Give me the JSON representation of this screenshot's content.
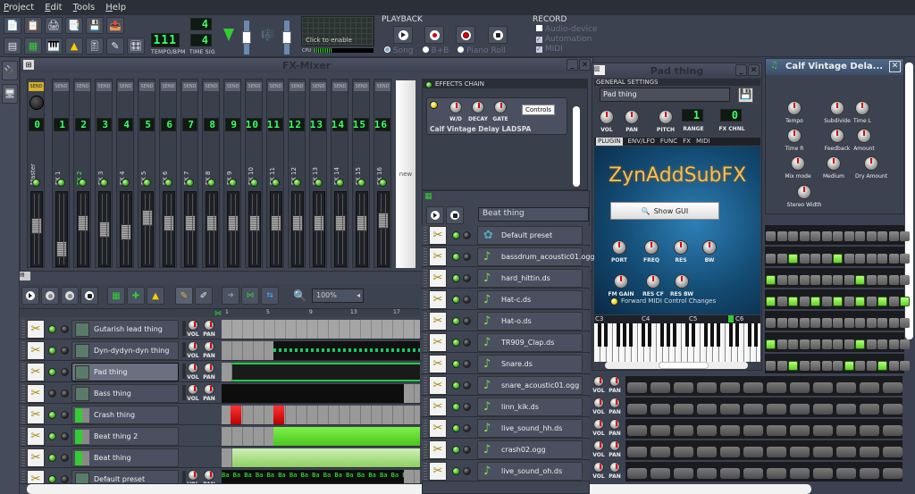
{
  "menu": [
    "Project",
    "Edit",
    "Tools",
    "Help"
  ],
  "toolbar": {
    "tempo": "111",
    "tempo_label": "TEMPO/BPM",
    "timesig_num": "4",
    "timesig_den": "4",
    "timesig_label": "TIME SIG",
    "cpu_label": "CPU",
    "graph_text": "Click to enable",
    "playback_label": "PLAYBACK",
    "modes": [
      "Song",
      "B+B",
      "Piano Roll"
    ],
    "selected_mode": "Song",
    "record_label": "RECORD",
    "record_options": [
      {
        "label": "Audio-device",
        "checked": false
      },
      {
        "label": "Automation",
        "checked": true
      },
      {
        "label": "MIDI",
        "checked": true
      }
    ]
  },
  "fxmixer": {
    "title": "FX-Mixer",
    "send_label": "SEND",
    "new_label": "new",
    "channels": [
      {
        "num": "0",
        "name": "Master",
        "level": 0.55
      },
      {
        "num": "1",
        "name": "FX 1",
        "level": 0.15
      },
      {
        "num": "2",
        "name": "FX 2",
        "level": 0.6,
        "active": true
      },
      {
        "num": "3",
        "name": "FX 3",
        "level": 0.5
      },
      {
        "num": "4",
        "name": "FX 4",
        "level": 0.45
      },
      {
        "num": "5",
        "name": "FX 5",
        "level": 0.7
      },
      {
        "num": "6",
        "name": "FX 6",
        "level": 0.6
      },
      {
        "num": "7",
        "name": "FX 7",
        "level": 0.6
      },
      {
        "num": "8",
        "name": "FX 8",
        "level": 0.6
      },
      {
        "num": "9",
        "name": "FX 9",
        "level": 0.6
      },
      {
        "num": "10",
        "name": "FX 10",
        "level": 0.6
      },
      {
        "num": "11",
        "name": "FX 11",
        "level": 0.6
      },
      {
        "num": "12",
        "name": "FX 12",
        "level": 0.6
      },
      {
        "num": "13",
        "name": "FX 13",
        "level": 0.6
      },
      {
        "num": "14",
        "name": "FX 14",
        "level": 0.6
      },
      {
        "num": "15",
        "name": "FX 15",
        "level": 0.6
      },
      {
        "num": "16",
        "name": "FX 16",
        "level": 0.65
      }
    ],
    "effects_chain": {
      "label": "EFFECTS CHAIN",
      "plugin": "Calf Vintage Delay LADSPA",
      "knobs": [
        "W/D",
        "DECAY",
        "GATE"
      ],
      "controls_btn": "Controls"
    }
  },
  "song_editor": {
    "zoom": "100%",
    "ruler": [
      "1",
      "5",
      "9",
      "13",
      "17"
    ],
    "tracks": [
      {
        "name": "Gutarish lead thing",
        "type": "synth"
      },
      {
        "name": "Dyn-dydyn-dyn thing",
        "type": "synth"
      },
      {
        "name": "Pad thing",
        "type": "synth",
        "selected": true
      },
      {
        "name": "Bass thing",
        "type": "synth"
      },
      {
        "name": "Crash thing",
        "type": "bb"
      },
      {
        "name": "Beat thing 2",
        "type": "bb"
      },
      {
        "name": "Beat thing",
        "type": "bb"
      },
      {
        "name": "Default preset",
        "type": "synth"
      }
    ],
    "vol_label": "VOL",
    "pan_label": "PAN",
    "pattern_label": "Ba"
  },
  "bb_editor": {
    "selected": "Beat thing",
    "tracks": [
      "Default preset",
      "bassdrum_acoustic01.ogg",
      "hard_hittin.ds",
      "Hat-c.ds",
      "Hat-o.ds",
      "TR909_Clap.ds",
      "Snare.ds",
      "snare_acoustic01.ogg",
      "linn_kik.ds",
      "live_sound_hh.ds",
      "crash02.ogg",
      "live_sound_oh.ds"
    ]
  },
  "instrument": {
    "title": "Pad thing",
    "general_label": "GENERAL SETTINGS",
    "name": "Pad thing",
    "knobs": [
      "VOL",
      "PAN",
      "PITCH"
    ],
    "range_label": "RANGE",
    "range": "1",
    "fx_label": "FX CHNL",
    "fx": "0",
    "tabs": [
      "PLUGIN",
      "ENV/LFO",
      "FUNC",
      "FX",
      "MIDI"
    ],
    "plugin_name": "ZynAddSubFX",
    "show_gui": "Show GUI",
    "zyn_knobs": [
      "PORT",
      "FREQ",
      "RES",
      "BW",
      "FM GAIN",
      "RES CF",
      "RES BW"
    ],
    "forward_midi": "Forward MIDI Control Changes",
    "octaves": [
      "C3",
      "C4",
      "C5",
      "C6"
    ]
  },
  "calf": {
    "title": "Calf Vintage Dela...",
    "knobs": [
      "Tempo",
      "Subdivide",
      "Time L",
      "Time R",
      "Feedback",
      "Amount",
      "Mix mode",
      "Medium",
      "Dry Amount",
      "Stereo Width"
    ]
  },
  "steps": [
    [],
    [
      2,
      6
    ],
    [
      0,
      8
    ],
    [
      0,
      2,
      4,
      6,
      8,
      10,
      12
    ],
    [],
    [
      0,
      8
    ],
    [
      2,
      7,
      10
    ]
  ]
}
